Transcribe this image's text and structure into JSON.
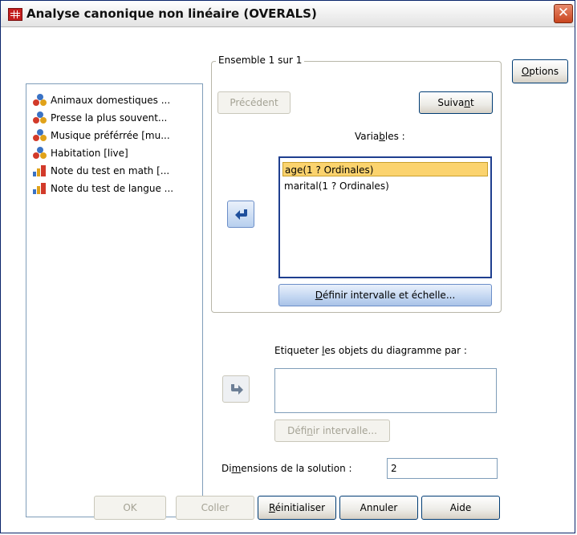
{
  "window": {
    "title": "Analyse canonique non linéaire (OVERALS)",
    "close_glyph": "✕"
  },
  "source_variables": [
    {
      "label": "Animaux domestiques ...",
      "icon": "nominal-icon"
    },
    {
      "label": "Presse la plus souvent...",
      "icon": "nominal-icon"
    },
    {
      "label": "Musique préférrée [mu...",
      "icon": "nominal-icon"
    },
    {
      "label": "Habitation [live]",
      "icon": "nominal-icon"
    },
    {
      "label": "Note du test en math [...",
      "icon": "scale-icon"
    },
    {
      "label": "Note du test de langue ...",
      "icon": "scale-icon"
    }
  ],
  "set_group": {
    "label": "Ensemble 1 sur 1",
    "previous_button": "Précédent",
    "next_button_pre": "Suiva",
    "next_button_u": "n",
    "next_button_post": "t",
    "variables_label_pre": "Varia",
    "variables_label_u": "b",
    "variables_label_post": "les :",
    "selected_variables": [
      {
        "label": "age(1 ? Ordinales)",
        "selected": true
      },
      {
        "label": "marital(1 ? Ordinales)",
        "selected": false
      }
    ],
    "define_range_scale_u": "D",
    "define_range_scale_post": "éfinir intervalle et échelle..."
  },
  "options_button_u": "O",
  "options_button_post": "ptions",
  "label_objects": {
    "label_pre": "Etiqueter ",
    "label_u": "l",
    "label_post": "es objets du diagramme par :",
    "value": "",
    "define_range_pre": "Défi",
    "define_range_u": "n",
    "define_range_post": "ir intervalle..."
  },
  "dimensions": {
    "label_pre": "Di",
    "label_u": "m",
    "label_post": "ensions de la solution :",
    "value": "2"
  },
  "buttons": {
    "ok": "OK",
    "paste": "Coller",
    "reset_u": "R",
    "reset_post": "éinitialiser",
    "cancel": "Annuler",
    "help": "Aide"
  },
  "colors": {
    "selection": "#fbd36e",
    "accent_blue": "#6b8ec8"
  }
}
